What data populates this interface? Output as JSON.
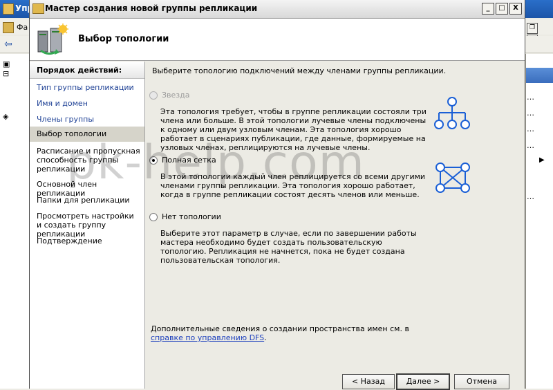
{
  "background_window": {
    "title_partial": "Упр",
    "menu_partial": "Фа"
  },
  "wizard": {
    "title": "Мастер создания новой группы репликации",
    "heading": "Выбор топологии",
    "nav_header": "Порядок действий:",
    "nav_items": [
      {
        "label": "Тип группы репликации"
      },
      {
        "label": "Имя и домен"
      },
      {
        "label": "Члены группы репликации"
      },
      {
        "label": "Выбор топологии"
      },
      {
        "label": "Расписание и пропускная способность группы репликации"
      },
      {
        "label": "Основной член репликации"
      },
      {
        "label": "Папки для репликации"
      },
      {
        "label": "Просмотреть настройки и создать группу репликации"
      },
      {
        "label": "Подтверждение"
      }
    ],
    "intro": "Выберите топологию подключений между членами группы репликации.",
    "options": {
      "star": {
        "label": "Звезда",
        "description": "Эта топология требует, чтобы в группе репликации состояли три члена или больше. В этой топологии лучевые члены подключены к одному или двум узловым членам. Эта топология хорошо работает в сценариях публикации, где данные, формируемые на узловых членах, реплицируются на лучевые члены."
      },
      "full_mesh": {
        "label": "Полная сетка",
        "description": "В этой топологии каждый член реплицируется со всеми другими членами группы репликации. Эта топология хорошо работает, когда в группе репликации состоят десять членов или меньше."
      },
      "no_topology": {
        "label": "Нет топологии",
        "description": "Выберите этот параметр в случае, если по завершении работы мастера необходимо будет создать пользовательскую топологию. Репликация не начнется, пока не будет создана пользовательская топология."
      }
    },
    "more_info_prefix": "Дополнительные сведения о создании пространства имен см. в ",
    "more_info_link": "справке по управлению DFS",
    "more_info_suffix": ".",
    "buttons": {
      "back": "< Назад",
      "next": "Далее >",
      "cancel": "Отмена"
    },
    "window_controls": {
      "minimize": "_",
      "maximize": "□",
      "close": "X"
    }
  },
  "watermark": "pk-help.com",
  "colors": {
    "icon_blue": "#1a5fd6",
    "link_blue": "#1c3fbd",
    "selected_nav": "#d6d4ca"
  }
}
